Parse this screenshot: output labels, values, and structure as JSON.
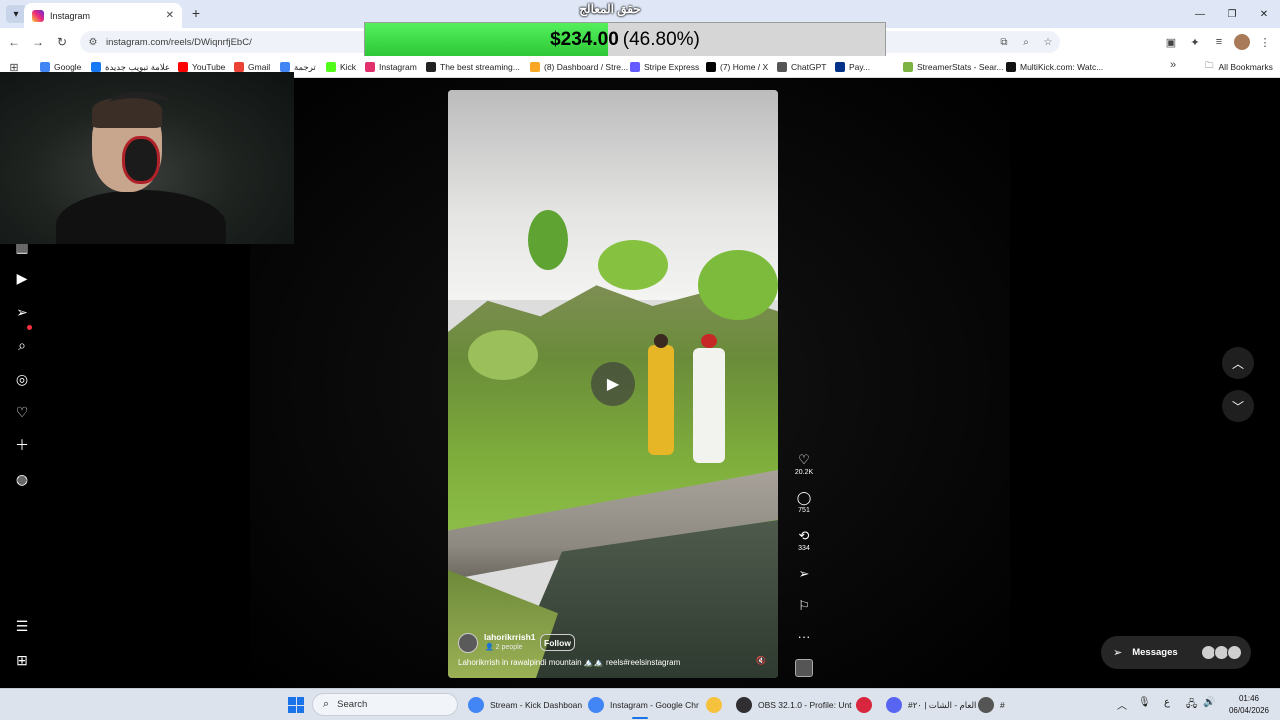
{
  "browser": {
    "tab": {
      "title": "Instagram"
    },
    "new_tab_icon": "plus-icon",
    "url": "instagram.com/reels/DWiqnrfjEbC/",
    "bookmarks": [
      {
        "label": "Google",
        "color": "#4285f4"
      },
      {
        "label": "علامة تبويب جديدة",
        "color": "#1877f2"
      },
      {
        "label": "YouTube",
        "color": "#ff0000"
      },
      {
        "label": "Gmail",
        "color": "#ea4335"
      },
      {
        "label": "ترجمة",
        "color": "#4285f4"
      },
      {
        "label": "Kick",
        "color": "#53fc18"
      },
      {
        "label": "Instagram",
        "color": "#e1306c"
      },
      {
        "label": "The best streaming...",
        "color": "#222222"
      },
      {
        "label": "(8) Dashboard / Stre...",
        "color": "#f9a825"
      },
      {
        "label": "Stripe Express",
        "color": "#635bff"
      },
      {
        "label": "(7) Home / X",
        "color": "#000000"
      },
      {
        "label": "ChatGPT",
        "color": "#555555"
      },
      {
        "label": "Pay...",
        "color": "#003087"
      },
      {
        "label": "StreamerStats - Sear...",
        "color": "#7cb342"
      },
      {
        "label": "MultiKick.com: Watc...",
        "color": "#111111"
      }
    ],
    "all_bookmarks": "All Bookmarks"
  },
  "overlay": {
    "title": "حقق المعالج",
    "donation_amount": "$234.00",
    "donation_percent": "(46.80%)",
    "progress_fraction": 0.468,
    "progress_color": "#3cd946"
  },
  "instagram": {
    "reel": {
      "username": "lahorikrrish1",
      "people": "2 people",
      "follow_label": "Follow",
      "caption": "Lahorikrrish in rawalpindi mountain 🏔️🏔️ reels#reelsinstagram"
    },
    "actions": {
      "likes": "20.2K",
      "comments": "751",
      "reposts": "334"
    },
    "messages_label": "Messages"
  },
  "taskbar": {
    "search_label": "Search",
    "apps": [
      {
        "label": "Stream - Kick Dashboan",
        "color": "#4285f4"
      },
      {
        "label": "Instagram - Google Chr",
        "color": "#4285f4"
      },
      {
        "label": "",
        "color": "#f6c23e"
      },
      {
        "label": "OBS 32.1.0 - Profile: Unt",
        "color": "#302e31"
      },
      {
        "label": "",
        "color": "#d7263d"
      },
      {
        "label": "#العام - الشات | ٢٠",
        "color": "#5865f2"
      },
      {
        "label": "#",
        "color": "#555555"
      }
    ],
    "lang": "ع",
    "time": "01:46",
    "date": "06/04/2026"
  }
}
